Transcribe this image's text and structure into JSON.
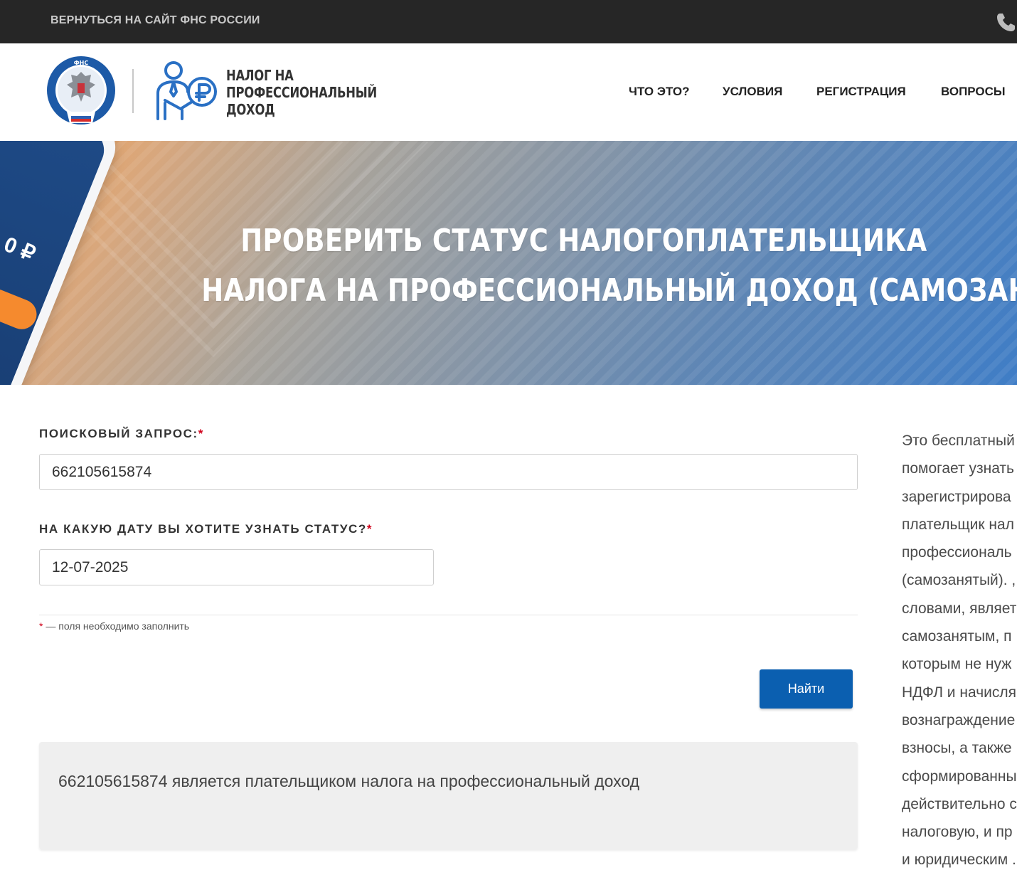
{
  "topbar": {
    "back_link": "ВЕРНУТЬСЯ НА САЙТ ФНС РОССИИ"
  },
  "header": {
    "brand_lines": [
      "НАЛОГ НА",
      "ПРОФЕССИОНАЛЬНЫЙ",
      "ДОХОД"
    ],
    "nav": [
      "ЧТО ЭТО?",
      "УСЛОВИЯ",
      "РЕГИСТРАЦИЯ",
      "ВОПРОСЫ"
    ]
  },
  "hero": {
    "title_line1": "ПРОВЕРИТЬ СТАТУС НАЛОГОПЛАТЕЛЬЩИКА",
    "title_line2": "НАЛОГА НА ПРОФЕССИОНАЛЬНЫЙ ДОХОД (САМОЗАНЯТОГО)",
    "phone_amount": "0 ₽"
  },
  "form": {
    "query_label": "ПОИСКОВЫЙ ЗАПРОС:",
    "query_value": "662105615874",
    "date_label": "НА КАКУЮ ДАТУ ВЫ ХОТИТЕ УЗНАТЬ СТАТУС?",
    "date_value": "12-07-2025",
    "required_mark": "*",
    "required_note": "— поля необходимо заполнить",
    "submit_label": "Найти"
  },
  "result": {
    "text": "662105615874 является плательщиком налога на профессиональный доход"
  },
  "side_info": {
    "lines": [
      "Это бесплатный",
      "помогает узнать",
      "зарегистрирова",
      "плательщик нал",
      "профессиональ",
      "(самозанятый). ,",
      "словами, являет",
      "самозанятым, п",
      "которым не нуж",
      "НДФЛ и начисля",
      "вознаграждение",
      "взносы, а также",
      "сформированны",
      "действительно с",
      "налоговую, и пр",
      "и юридическим ."
    ]
  },
  "colors": {
    "topbar": "#262626",
    "accent_button": "#0b5fb0",
    "required": "#d0021b",
    "result_bg": "#efefef"
  },
  "icons": [
    "phone-icon",
    "fns-emblem-logo",
    "npd-logo-icon"
  ]
}
